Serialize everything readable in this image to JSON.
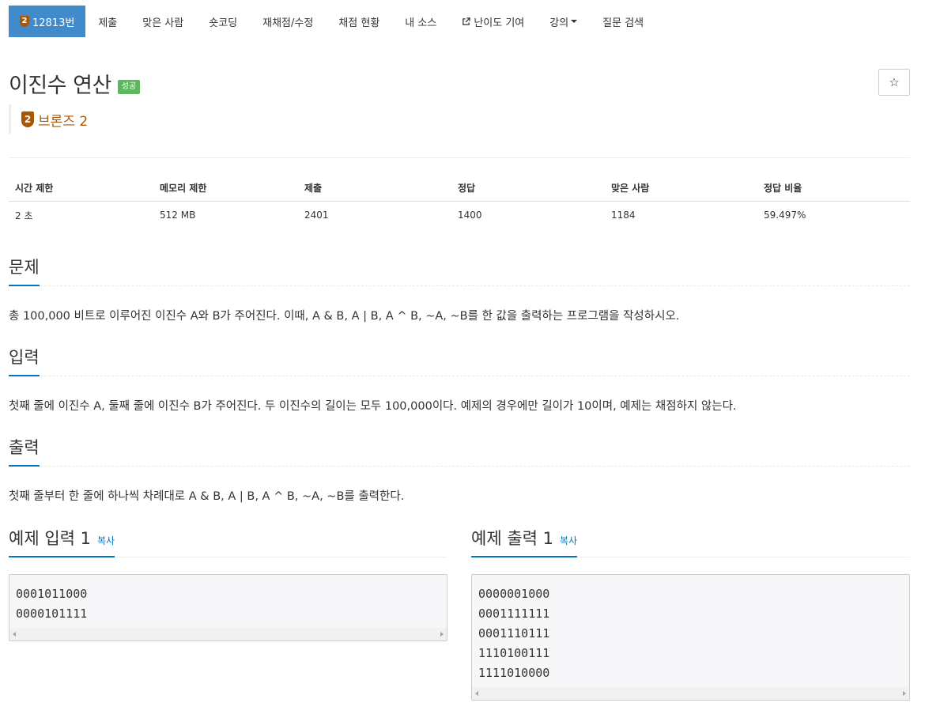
{
  "nav": {
    "problem_id": "12813번",
    "badge": "2",
    "items": [
      "제출",
      "맞은 사람",
      "숏코딩",
      "재채점/수정",
      "채점 현황",
      "내 소스",
      "난이도 기여",
      "강의",
      "질문 검색"
    ]
  },
  "problem": {
    "title": "이진수 연산",
    "status_badge": "성공",
    "star": "☆",
    "tier_number": "2",
    "tier_label": "브론즈 2",
    "tier_color": "#ad5600"
  },
  "stats": {
    "headers": [
      "시간 제한",
      "메모리 제한",
      "제출",
      "정답",
      "맞은 사람",
      "정답 비율"
    ],
    "values": [
      "2 초",
      "512 MB",
      "2401",
      "1400",
      "1184",
      "59.497%"
    ]
  },
  "sections": {
    "problem_title": "문제",
    "problem_text": "총 100,000 비트로 이루어진 이진수 A와 B가 주어진다. 이때, A & B, A | B, A ^ B, ~A, ~B를 한 값을 출력하는 프로그램을 작성하시오.",
    "input_title": "입력",
    "input_text": "첫째 줄에 이진수 A, 둘째 줄에 이진수 B가 주어진다. 두 이진수의 길이는 모두 100,000이다. 예제의 경우에만 길이가 10이며, 예제는 채점하지 않는다.",
    "output_title": "출력",
    "output_text": "첫째 줄부터 한 줄에 하나씩 차례대로 A & B, A | B, A ^ B, ~A, ~B를 출력한다."
  },
  "samples": {
    "input_title": "예제 입력 1",
    "output_title": "예제 출력 1",
    "copy_label": "복사",
    "input_lines": [
      "0001011000",
      "0000101111"
    ],
    "output_lines": [
      "0000001000",
      "0001111111",
      "0001110111",
      "1110100111",
      "1111010000"
    ]
  },
  "colors": {
    "accent": "#428bca",
    "link": "#0076c0",
    "success": "#5cb85c"
  }
}
